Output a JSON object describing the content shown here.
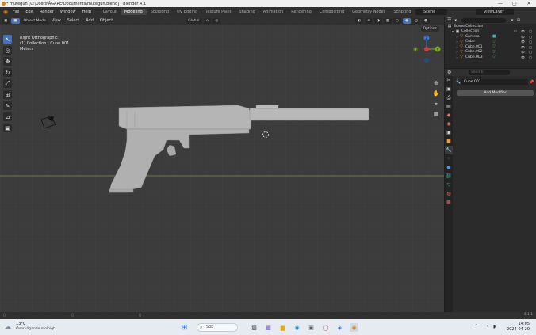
{
  "window": {
    "title": "* mutegun [C:\\Users\\ÅGARE\\Documents\\mutegun.blend] - Blender 4.1",
    "controls": [
      "—",
      "▢",
      "✕"
    ]
  },
  "topbar": {
    "menus": [
      "File",
      "Edit",
      "Render",
      "Window",
      "Help"
    ],
    "tabs": [
      "Layout",
      "Modeling",
      "Sculpting",
      "UV Editing",
      "Texture Paint",
      "Shading",
      "Animation",
      "Rendering",
      "Compositing",
      "Geometry Nodes",
      "Scripting"
    ],
    "active_tab": "Modeling",
    "add_tab": "+",
    "scene": "Scene",
    "view_layer": "ViewLayer"
  },
  "viewport": {
    "mode": "Object Mode",
    "menus": [
      "View",
      "Select",
      "Add",
      "Object"
    ],
    "transform": "Global",
    "overlay_view": "Right Orthographic",
    "overlay_collection": "(1) Collection | Cube.001",
    "overlay_units": "Meters",
    "options": "Options",
    "gizmo_axes": {
      "y": "Y",
      "z": "Z",
      "neg_y": "-Y"
    },
    "colors": {
      "background": "#3c3c3c",
      "grid": "#444444",
      "x_axis": "#8a9b3a",
      "mesh": "#b8b8b8"
    }
  },
  "outliner": {
    "title": "Scene Collection",
    "items": [
      {
        "label": "Collection",
        "indent": 1
      },
      {
        "label": "Camera",
        "indent": 2
      },
      {
        "label": "Cube",
        "indent": 2
      },
      {
        "label": "Cube.001",
        "indent": 2
      },
      {
        "label": "Cube.002",
        "indent": 2
      },
      {
        "label": "Cube.003",
        "indent": 2
      }
    ]
  },
  "properties": {
    "search_placeholder": "Search",
    "object_name": "Cube.001",
    "add_modifier": "Add Modifier"
  },
  "statusbar": {
    "version": "4.1.1"
  },
  "taskbar": {
    "temp": "13°C",
    "condition": "Övervägande molnigt",
    "search": "Sök",
    "time": "14:05",
    "date": "2024-04-29"
  }
}
